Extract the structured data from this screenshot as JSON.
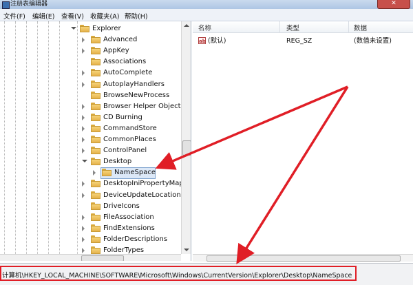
{
  "window": {
    "title": "注册表编辑器",
    "close_glyph": "✕"
  },
  "menu": [
    {
      "label": "文件(F)"
    },
    {
      "label": "编辑(E)"
    },
    {
      "label": "查看(V)"
    },
    {
      "label": "收藏夹(A)"
    },
    {
      "label": "帮助(H)"
    }
  ],
  "tree": {
    "items": [
      {
        "label": "Explorer",
        "level": 0,
        "state": "open"
      },
      {
        "label": "Advanced",
        "level": 1,
        "state": "closed"
      },
      {
        "label": "AppKey",
        "level": 1,
        "state": "closed"
      },
      {
        "label": "Associations",
        "level": 1,
        "state": "none"
      },
      {
        "label": "AutoComplete",
        "level": 1,
        "state": "closed"
      },
      {
        "label": "AutoplayHandlers",
        "level": 1,
        "state": "closed"
      },
      {
        "label": "BrowseNewProcess",
        "level": 1,
        "state": "none"
      },
      {
        "label": "Browser Helper Objects",
        "level": 1,
        "state": "closed"
      },
      {
        "label": "CD Burning",
        "level": 1,
        "state": "closed"
      },
      {
        "label": "CommandStore",
        "level": 1,
        "state": "closed"
      },
      {
        "label": "CommonPlaces",
        "level": 1,
        "state": "closed"
      },
      {
        "label": "ControlPanel",
        "level": 1,
        "state": "closed"
      },
      {
        "label": "Desktop",
        "level": 1,
        "state": "open"
      },
      {
        "label": "NameSpace",
        "level": 2,
        "state": "closed",
        "selected": true
      },
      {
        "label": "DesktopIniPropertyMap",
        "level": 1,
        "state": "closed"
      },
      {
        "label": "DeviceUpdateLocations",
        "level": 1,
        "state": "closed"
      },
      {
        "label": "DriveIcons",
        "level": 1,
        "state": "none"
      },
      {
        "label": "FileAssociation",
        "level": 1,
        "state": "closed"
      },
      {
        "label": "FindExtensions",
        "level": 1,
        "state": "closed"
      },
      {
        "label": "FolderDescriptions",
        "level": 1,
        "state": "closed"
      },
      {
        "label": "FolderTypes",
        "level": 1,
        "state": "closed"
      }
    ]
  },
  "list": {
    "columns": [
      "名称",
      "类型",
      "数据"
    ],
    "rows": [
      {
        "name": "(默认)",
        "type": "REG_SZ",
        "data": "(数值未设置)",
        "icon": "ab-string-icon"
      }
    ]
  },
  "status": {
    "path": "计算机\\HKEY_LOCAL_MACHINE\\SOFTWARE\\Microsoft\\Windows\\CurrentVersion\\Explorer\\Desktop\\NameSpace"
  },
  "colors": {
    "annotation": "#e01e26",
    "folder": "#f0c45c",
    "selection": "#dce8f7"
  }
}
